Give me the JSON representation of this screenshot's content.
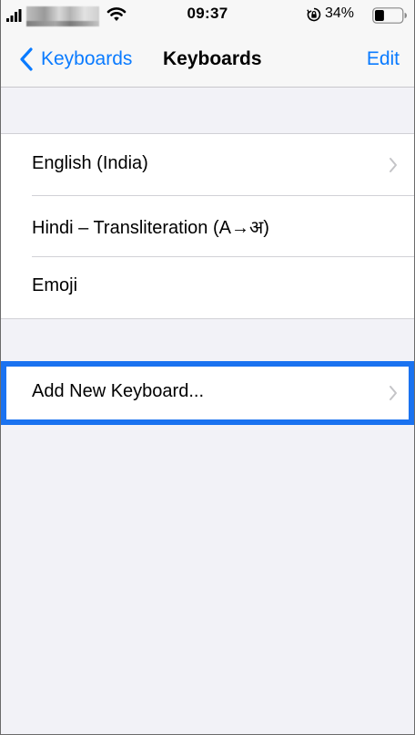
{
  "status_bar": {
    "time": "09:37",
    "battery_percent": "34%",
    "battery_level": 0.34,
    "icons": [
      "signal-icon",
      "wifi-icon",
      "rotation-lock-icon",
      "battery-icon"
    ]
  },
  "nav": {
    "back_label": "Keyboards",
    "title": "Keyboards",
    "edit_label": "Edit",
    "accent_color": "#0a7bff"
  },
  "keyboards": [
    {
      "label": "English (India)",
      "chevron": true
    },
    {
      "label": "Hindi – Transliteration (A→अ)",
      "chevron": false
    },
    {
      "label": "Emoji",
      "chevron": false
    }
  ],
  "add_keyboard": {
    "label": "Add New Keyboard...",
    "highlight_color": "#1a72f0"
  }
}
